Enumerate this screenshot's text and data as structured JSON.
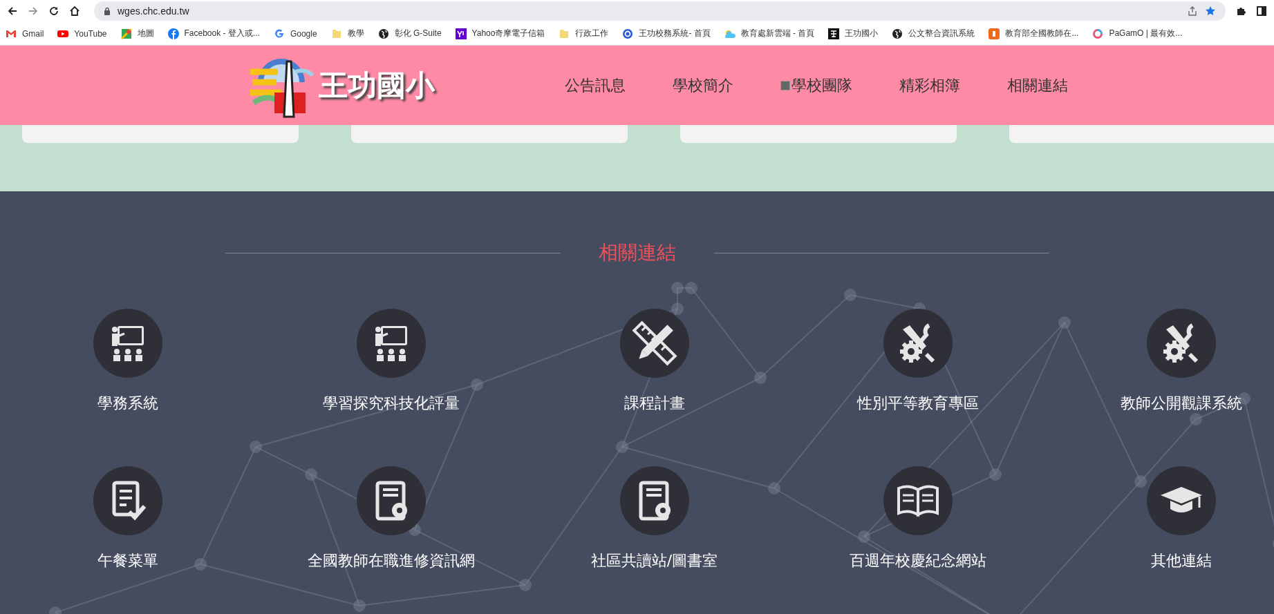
{
  "browser": {
    "url": "wges.chc.edu.tw",
    "bookmarks": [
      {
        "label": "Gmail"
      },
      {
        "label": "YouTube"
      },
      {
        "label": "地圖"
      },
      {
        "label": "Facebook - 登入或..."
      },
      {
        "label": "Google"
      },
      {
        "label": "教學"
      },
      {
        "label": "彰化 G-Suite"
      },
      {
        "label": "Yahoo奇摩電子信箱"
      },
      {
        "label": "行政工作"
      },
      {
        "label": "王功校務系統- 首頁"
      },
      {
        "label": "教育處新雲端 - 首頁"
      },
      {
        "label": "王功國小"
      },
      {
        "label": "公文整合資訊系統"
      },
      {
        "label": "教育部全國教師在..."
      },
      {
        "label": "PaGamO | 最有效..."
      }
    ]
  },
  "header": {
    "site_name": "王功國小",
    "nav": [
      {
        "label": "公告訊息"
      },
      {
        "label": "學校簡介"
      },
      {
        "label": "學校團隊"
      },
      {
        "label": "精彩相簿"
      },
      {
        "label": "相關連結"
      }
    ]
  },
  "links_section": {
    "title": "相關連結",
    "links": [
      {
        "label": "學務系統"
      },
      {
        "label": "學習探究科技化評量"
      },
      {
        "label": "課程計畫"
      },
      {
        "label": "性別平等教育專區"
      },
      {
        "label": "教師公開觀課系統"
      },
      {
        "label": "午餐菜單"
      },
      {
        "label": "全國教師在職進修資訊網"
      },
      {
        "label": "社區共讀站/圖書室"
      },
      {
        "label": "百週年校慶紀念網站"
      },
      {
        "label": "其他連結"
      }
    ]
  }
}
